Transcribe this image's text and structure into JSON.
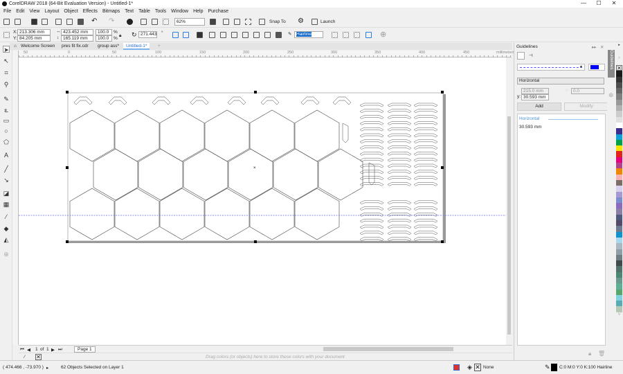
{
  "window": {
    "title": "CorelDRAW 2018 (64-Bit Evaluation Version) - Untitled-1*",
    "minimize": "—",
    "maximize": "☐",
    "close": "✕"
  },
  "menu": [
    "File",
    "Edit",
    "View",
    "Layout",
    "Object",
    "Effects",
    "Bitmaps",
    "Text",
    "Table",
    "Tools",
    "Window",
    "Help",
    "Purchase"
  ],
  "toolbar": {
    "zoom": "62%",
    "snap_to": "Snap To",
    "launch": "Launch"
  },
  "propbar": {
    "x_label": "X:",
    "x": "213.306 mm",
    "y_label": "Y:",
    "y": "84.205 mm",
    "width": "423.452 mm",
    "height": "165.119 mm",
    "scale_x": "100.0",
    "scale_y": "100.0",
    "pct": "%",
    "rotation": "271.443",
    "degree": "°",
    "outline": "Hairline"
  },
  "tabs": [
    "Welcome Screen",
    "pres fit fix.cdr",
    "group ass*",
    "Untitled-1*"
  ],
  "ruler": {
    "labels": [
      "50",
      "0",
      "50",
      "100",
      "150",
      "200",
      "250",
      "300",
      "350",
      "400",
      "450"
    ],
    "unit": "millimeters"
  },
  "page_nav": {
    "current": "1",
    "of": "of",
    "total": "1",
    "page_tab": "Page 1"
  },
  "doc_palette_hint": "Drag colors (or objects) here to store these colors with your document",
  "status": {
    "coords": "( 474.466 , -73.970 )",
    "selection": "62 Objects Selected on Layer 1",
    "fill": "None",
    "outline": "C:0 M:0 Y:0 K:100  Hairline"
  },
  "docker": {
    "title": "Guidelines",
    "tab_label": "Guidelines",
    "guide_color": "#0000ff",
    "orientation": "Horizontal",
    "x": "215.0 mm",
    "y_label": "y:",
    "y": "30.593 mm",
    "angle": "0.0",
    "add": "Add",
    "modify": "Modify",
    "list_header": "Horizontal",
    "list_items": [
      "30.593 mm"
    ]
  },
  "palette": [
    "#1a1a1a",
    "#333333",
    "#4d4d4d",
    "#666666",
    "#808080",
    "#999999",
    "#b3b3b3",
    "#cccccc",
    "#e0e0e0",
    "#ffffff",
    "#3a2d8f",
    "#0ea0d8",
    "#00a04b",
    "#f7e300",
    "#e2231a",
    "#e6007e",
    "#b2418e",
    "#f18700",
    "#f7b3b6",
    "#7d6d67",
    "#d8d0ef",
    "#a79ad4",
    "#7b8fd0",
    "#8a6bbf",
    "#8b7fa8",
    "#4e5a80",
    "#564a6a",
    "#6c7b92",
    "#0e93d0",
    "#a8d8ef",
    "#a9b9c3",
    "#8d9ea7",
    "#6e7e84",
    "#3e4a4c",
    "#51726b",
    "#4e8676",
    "#6a9a8e",
    "#5fae96",
    "#5aa76e",
    "#7fd2df",
    "#58acb5",
    "#b5c9b9"
  ]
}
